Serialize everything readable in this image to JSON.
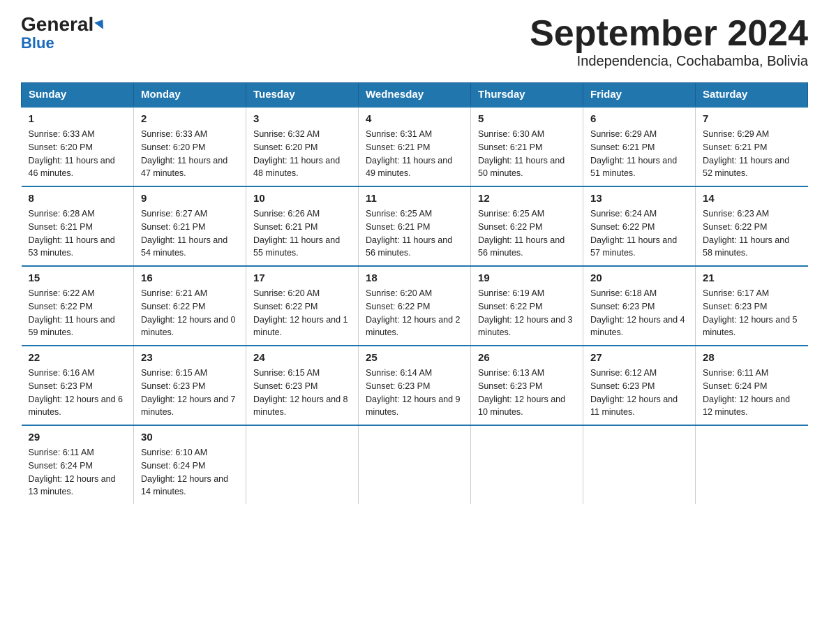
{
  "logo": {
    "general": "General",
    "arrow": "▶",
    "blue": "Blue"
  },
  "title": "September 2024",
  "subtitle": "Independencia, Cochabamba, Bolivia",
  "days_header": [
    "Sunday",
    "Monday",
    "Tuesday",
    "Wednesday",
    "Thursday",
    "Friday",
    "Saturday"
  ],
  "weeks": [
    [
      {
        "num": "1",
        "sunrise": "6:33 AM",
        "sunset": "6:20 PM",
        "daylight": "11 hours and 46 minutes."
      },
      {
        "num": "2",
        "sunrise": "6:33 AM",
        "sunset": "6:20 PM",
        "daylight": "11 hours and 47 minutes."
      },
      {
        "num": "3",
        "sunrise": "6:32 AM",
        "sunset": "6:20 PM",
        "daylight": "11 hours and 48 minutes."
      },
      {
        "num": "4",
        "sunrise": "6:31 AM",
        "sunset": "6:21 PM",
        "daylight": "11 hours and 49 minutes."
      },
      {
        "num": "5",
        "sunrise": "6:30 AM",
        "sunset": "6:21 PM",
        "daylight": "11 hours and 50 minutes."
      },
      {
        "num": "6",
        "sunrise": "6:29 AM",
        "sunset": "6:21 PM",
        "daylight": "11 hours and 51 minutes."
      },
      {
        "num": "7",
        "sunrise": "6:29 AM",
        "sunset": "6:21 PM",
        "daylight": "11 hours and 52 minutes."
      }
    ],
    [
      {
        "num": "8",
        "sunrise": "6:28 AM",
        "sunset": "6:21 PM",
        "daylight": "11 hours and 53 minutes."
      },
      {
        "num": "9",
        "sunrise": "6:27 AM",
        "sunset": "6:21 PM",
        "daylight": "11 hours and 54 minutes."
      },
      {
        "num": "10",
        "sunrise": "6:26 AM",
        "sunset": "6:21 PM",
        "daylight": "11 hours and 55 minutes."
      },
      {
        "num": "11",
        "sunrise": "6:25 AM",
        "sunset": "6:21 PM",
        "daylight": "11 hours and 56 minutes."
      },
      {
        "num": "12",
        "sunrise": "6:25 AM",
        "sunset": "6:22 PM",
        "daylight": "11 hours and 56 minutes."
      },
      {
        "num": "13",
        "sunrise": "6:24 AM",
        "sunset": "6:22 PM",
        "daylight": "11 hours and 57 minutes."
      },
      {
        "num": "14",
        "sunrise": "6:23 AM",
        "sunset": "6:22 PM",
        "daylight": "11 hours and 58 minutes."
      }
    ],
    [
      {
        "num": "15",
        "sunrise": "6:22 AM",
        "sunset": "6:22 PM",
        "daylight": "11 hours and 59 minutes."
      },
      {
        "num": "16",
        "sunrise": "6:21 AM",
        "sunset": "6:22 PM",
        "daylight": "12 hours and 0 minutes."
      },
      {
        "num": "17",
        "sunrise": "6:20 AM",
        "sunset": "6:22 PM",
        "daylight": "12 hours and 1 minute."
      },
      {
        "num": "18",
        "sunrise": "6:20 AM",
        "sunset": "6:22 PM",
        "daylight": "12 hours and 2 minutes."
      },
      {
        "num": "19",
        "sunrise": "6:19 AM",
        "sunset": "6:22 PM",
        "daylight": "12 hours and 3 minutes."
      },
      {
        "num": "20",
        "sunrise": "6:18 AM",
        "sunset": "6:23 PM",
        "daylight": "12 hours and 4 minutes."
      },
      {
        "num": "21",
        "sunrise": "6:17 AM",
        "sunset": "6:23 PM",
        "daylight": "12 hours and 5 minutes."
      }
    ],
    [
      {
        "num": "22",
        "sunrise": "6:16 AM",
        "sunset": "6:23 PM",
        "daylight": "12 hours and 6 minutes."
      },
      {
        "num": "23",
        "sunrise": "6:15 AM",
        "sunset": "6:23 PM",
        "daylight": "12 hours and 7 minutes."
      },
      {
        "num": "24",
        "sunrise": "6:15 AM",
        "sunset": "6:23 PM",
        "daylight": "12 hours and 8 minutes."
      },
      {
        "num": "25",
        "sunrise": "6:14 AM",
        "sunset": "6:23 PM",
        "daylight": "12 hours and 9 minutes."
      },
      {
        "num": "26",
        "sunrise": "6:13 AM",
        "sunset": "6:23 PM",
        "daylight": "12 hours and 10 minutes."
      },
      {
        "num": "27",
        "sunrise": "6:12 AM",
        "sunset": "6:23 PM",
        "daylight": "12 hours and 11 minutes."
      },
      {
        "num": "28",
        "sunrise": "6:11 AM",
        "sunset": "6:24 PM",
        "daylight": "12 hours and 12 minutes."
      }
    ],
    [
      {
        "num": "29",
        "sunrise": "6:11 AM",
        "sunset": "6:24 PM",
        "daylight": "12 hours and 13 minutes."
      },
      {
        "num": "30",
        "sunrise": "6:10 AM",
        "sunset": "6:24 PM",
        "daylight": "12 hours and 14 minutes."
      },
      null,
      null,
      null,
      null,
      null
    ]
  ]
}
